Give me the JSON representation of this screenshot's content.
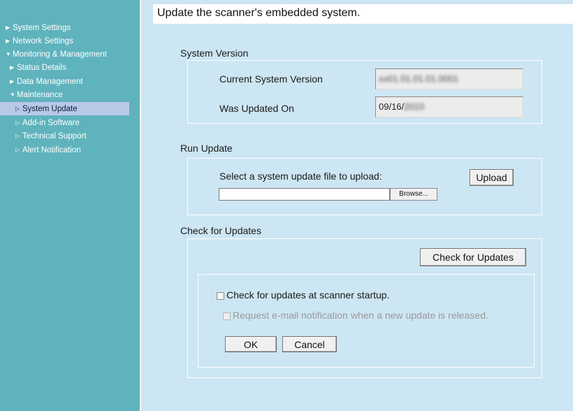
{
  "sidebar": {
    "items": [
      {
        "label": "System Settings",
        "arrow": "▶"
      },
      {
        "label": "Network Settings",
        "arrow": "▶"
      },
      {
        "label": "Monitoring & Management",
        "arrow": "▼"
      },
      {
        "label": "Status Details",
        "arrow": "▶"
      },
      {
        "label": "Data Management",
        "arrow": "▶"
      },
      {
        "label": "Maintenance",
        "arrow": "▼"
      },
      {
        "label": "System Update",
        "arrow": "▷",
        "selected": true
      },
      {
        "label": "Add-in Software",
        "arrow": "▷"
      },
      {
        "label": "Technical Support",
        "arrow": "▷"
      },
      {
        "label": "Alert Notification",
        "arrow": "▷"
      }
    ]
  },
  "header": {
    "title": "Update the scanner's embedded system."
  },
  "system_version": {
    "section_title": "System Version",
    "current_label": "Current System Version",
    "current_value": "xx01.01.01.01.0001",
    "updated_label": "Was Updated On",
    "updated_value_visible": "09/16/",
    "updated_value_obscured": "2010"
  },
  "run_update": {
    "section_title": "Run Update",
    "prompt": "Select a system update file to upload:",
    "upload_button": "Upload",
    "browse_button": "Browse...",
    "file_value": ""
  },
  "check_updates": {
    "section_title": "Check for Updates",
    "check_button": "Check for Updates",
    "startup_checkbox_label": "Check for updates at scanner startup.",
    "startup_checked": false,
    "email_checkbox_label": "Request e-mail notification when a new update is released.",
    "email_checked": false,
    "email_disabled": true,
    "ok_button": "OK",
    "cancel_button": "Cancel"
  },
  "colors": {
    "sidebar_bg": "#5fb3bd",
    "main_bg": "#cde6f3",
    "selected_item_bg": "#b8c9e8"
  }
}
